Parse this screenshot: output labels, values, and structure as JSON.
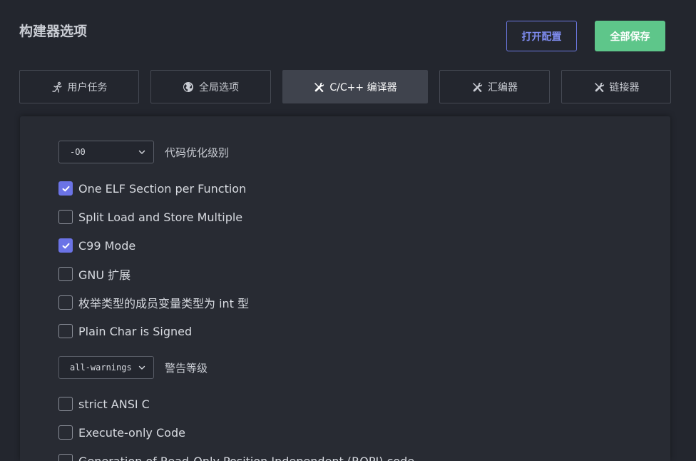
{
  "header": {
    "title": "构建器选项",
    "open_config_label": "打开配置",
    "save_all_label": "全部保存"
  },
  "tabs": [
    {
      "label": "用户任务",
      "icon": "run-icon",
      "active": false
    },
    {
      "label": "全局选项",
      "icon": "globe-icon",
      "active": false
    },
    {
      "label": "C/C++ 编译器",
      "icon": "tools-icon",
      "active": true
    },
    {
      "label": "汇编器",
      "icon": "tools-icon",
      "active": false
    },
    {
      "label": "链接器",
      "icon": "tools-icon",
      "active": false
    }
  ],
  "compiler": {
    "optimization": {
      "value": "-O0",
      "label": "代码优化级别"
    },
    "warnings": {
      "value": "all-warnings",
      "label": "警告等级"
    },
    "options_a": [
      {
        "label": "One ELF Section per Function",
        "checked": true
      },
      {
        "label": "Split Load and Store Multiple",
        "checked": false
      },
      {
        "label": "C99 Mode",
        "checked": true
      },
      {
        "label": "GNU 扩展",
        "checked": false
      },
      {
        "label": "枚举类型的成员变量类型为 int 型",
        "checked": false
      },
      {
        "label": "Plain Char is Signed",
        "checked": false
      }
    ],
    "options_b": [
      {
        "label": "strict ANSI C",
        "checked": false
      },
      {
        "label": "Execute-only Code",
        "checked": false
      },
      {
        "label": "Generation of Read-Only Position Independent (ROPI) code",
        "checked": false
      }
    ]
  },
  "colors": {
    "accent": "#6b73e6",
    "save_green": "#5ec68a",
    "background": "#23262e"
  }
}
